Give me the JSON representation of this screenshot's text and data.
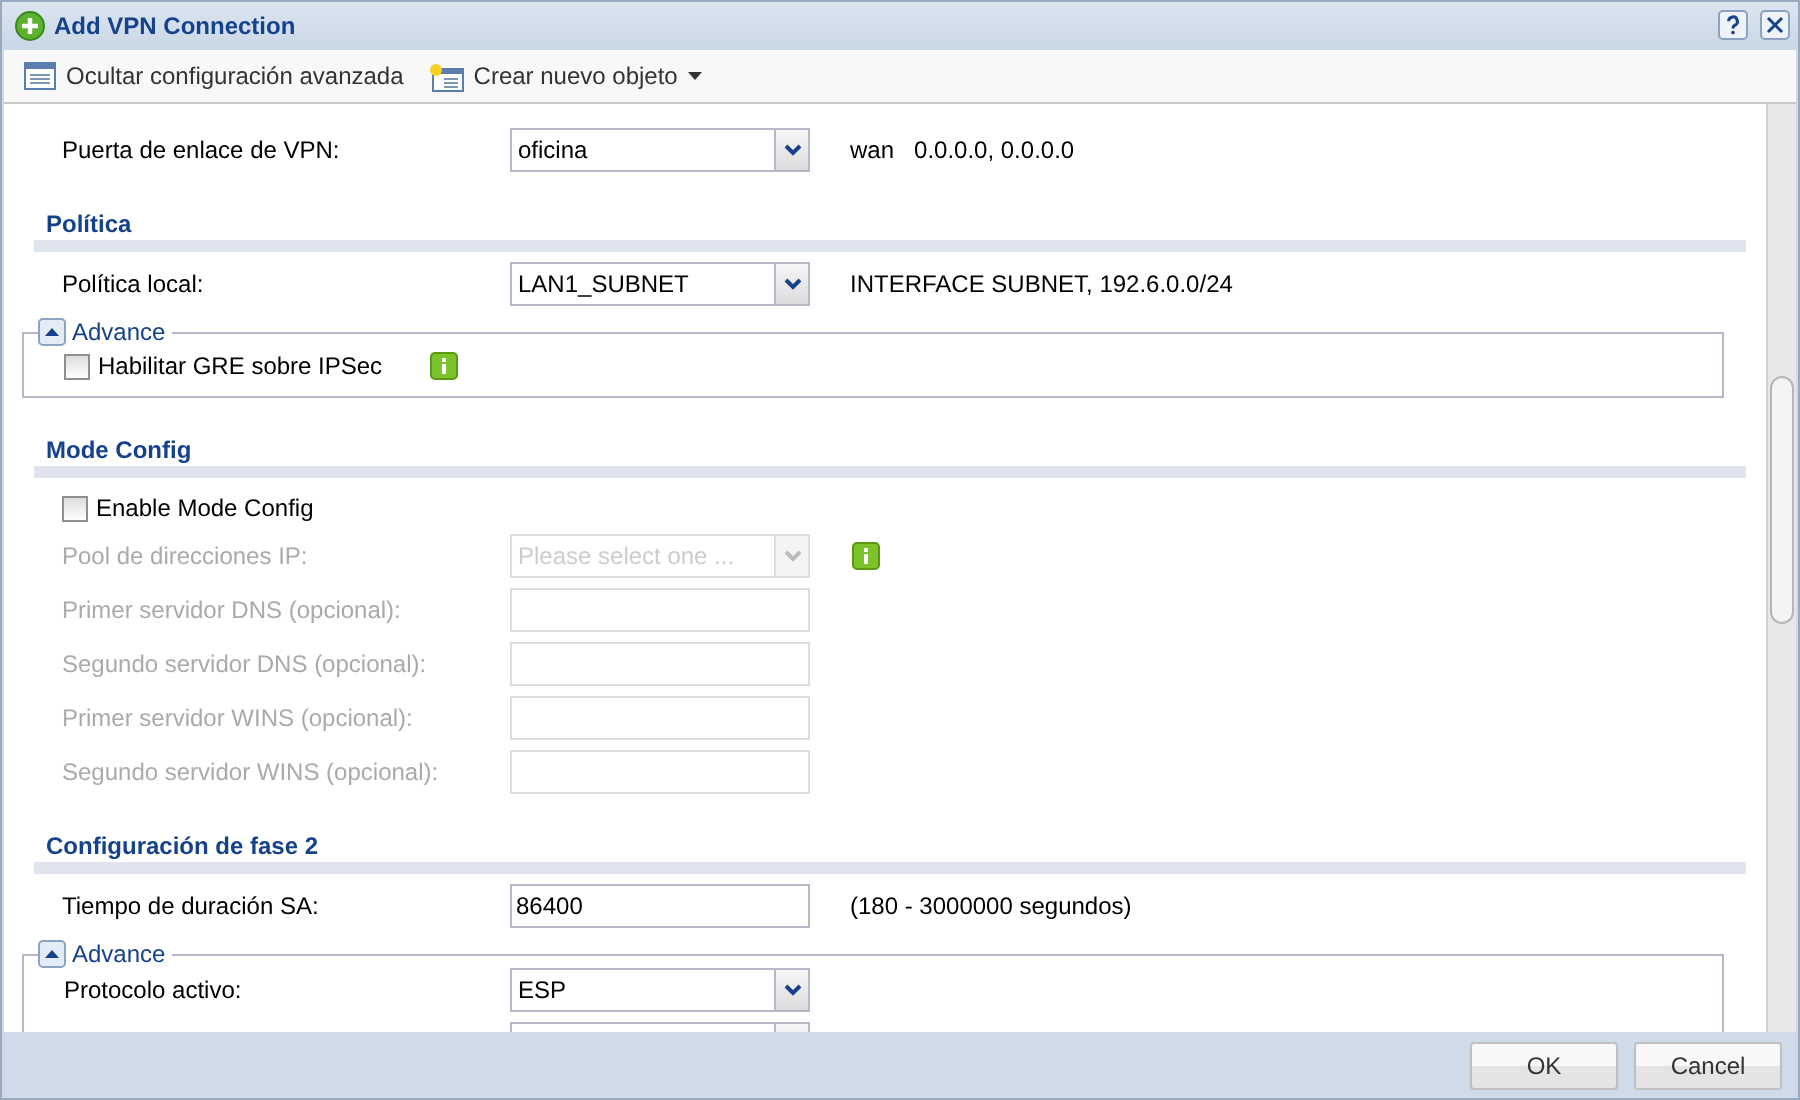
{
  "window": {
    "title": "Add VPN Connection"
  },
  "toolbar": [
    {
      "label": "Ocultar configuración avanzada",
      "kind": "list",
      "caret": false
    },
    {
      "label": "Crear nuevo objeto",
      "kind": "new",
      "caret": true
    }
  ],
  "form": [
    {
      "kind": "select",
      "label": "Puerta de enlace de VPN:",
      "value": "oficina",
      "disabled": false,
      "notes": [
        "wan",
        "0.0.0.0, 0.0.0.0"
      ]
    },
    {
      "kind": "heading",
      "label": "Política"
    },
    {
      "kind": "select",
      "label": "Política local:",
      "value": "LAN1_SUBNET",
      "disabled": false,
      "notes": [
        "INTERFACE SUBNET, 192.6.0.0/24"
      ]
    },
    {
      "kind": "group",
      "label": "Advance",
      "expanded": true,
      "items": [
        {
          "kind": "checkbox",
          "label": "Habilitar GRE sobre IPSec",
          "checked": false,
          "info": true
        }
      ]
    },
    {
      "kind": "heading",
      "label": "Mode Config"
    },
    {
      "kind": "checkbox",
      "label": "Enable Mode Config",
      "checked": false
    },
    {
      "kind": "select",
      "label": "Pool de direcciones IP:",
      "placeholder": "Please select one ...",
      "disabled": true,
      "info": true
    },
    {
      "kind": "text",
      "label": "Primer servidor DNS (opcional):",
      "disabled": true
    },
    {
      "kind": "text",
      "label": "Segundo servidor DNS (opcional):",
      "disabled": true
    },
    {
      "kind": "text",
      "label": "Primer servidor WINS (opcional):",
      "disabled": true
    },
    {
      "kind": "text",
      "label": "Segundo servidor WINS (opcional):",
      "disabled": true
    },
    {
      "kind": "heading",
      "label": "Configuración de fase 2"
    },
    {
      "kind": "text",
      "label": "Tiempo de duración SA:",
      "value": "86400",
      "disabled": false,
      "notes": [
        "(180 - 3000000 segundos)"
      ]
    },
    {
      "kind": "group",
      "label": "Advance",
      "expanded": true,
      "items": [
        {
          "kind": "select",
          "label": "Protocolo activo:",
          "value": "ESP",
          "disabled": false
        },
        {
          "kind": "select",
          "disabled": false
        }
      ]
    }
  ],
  "buttons": [
    "OK",
    "Cancel"
  ]
}
